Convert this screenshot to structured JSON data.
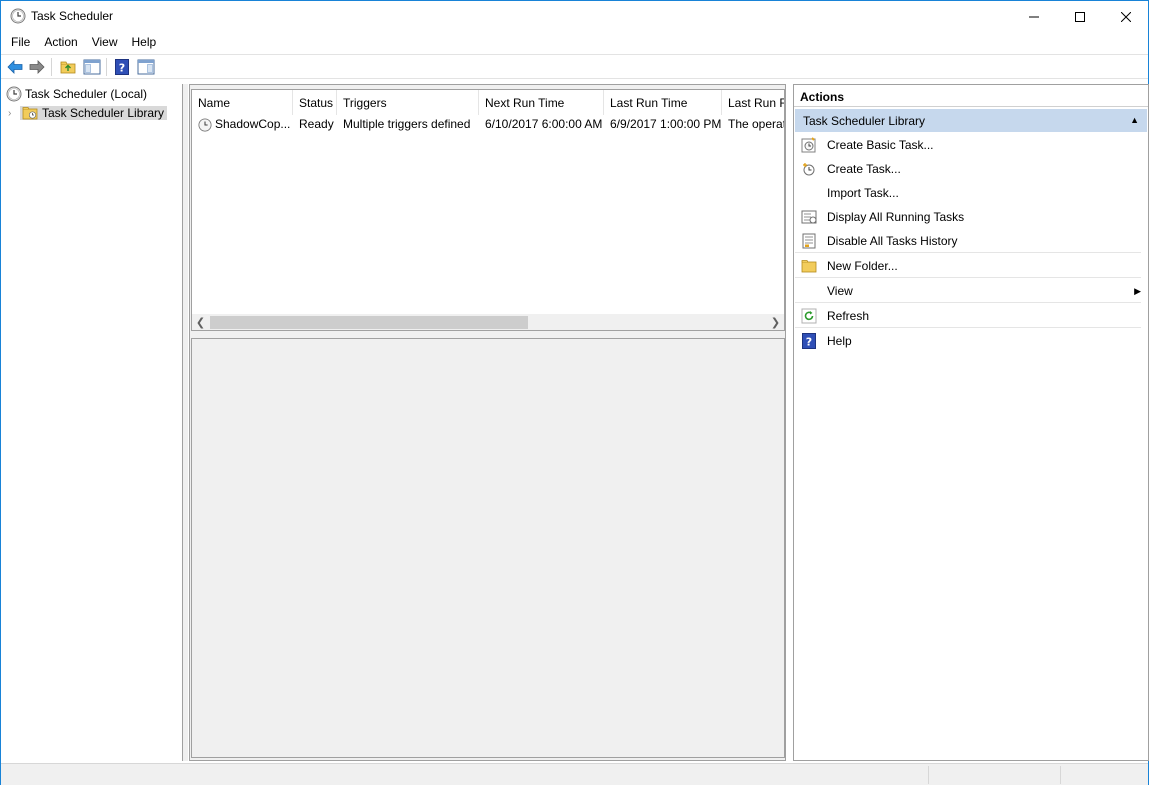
{
  "window": {
    "title": "Task Scheduler",
    "controls": {
      "minimize": "minimize",
      "maximize": "maximize",
      "close": "close"
    }
  },
  "menu": [
    "File",
    "Action",
    "View",
    "Help"
  ],
  "toolbar": {
    "buttons": [
      "back-arrow-icon",
      "forward-arrow-icon",
      "up-folder-icon",
      "show-hide-console-tree-icon",
      "help-icon",
      "show-hide-action-pane-icon"
    ]
  },
  "tree": {
    "root": "Task Scheduler (Local)",
    "child": "Task Scheduler Library"
  },
  "tasklist": {
    "columns": [
      "Name",
      "Status",
      "Triggers",
      "Next Run Time",
      "Last Run Time",
      "Last Run R"
    ],
    "rows": [
      {
        "name": "ShadowCop...",
        "status": "Ready",
        "triggers": "Multiple triggers defined",
        "next_run": "6/10/2017 6:00:00 AM",
        "last_run": "6/9/2017 1:00:00 PM",
        "last_result": "The operat"
      }
    ]
  },
  "actions": {
    "title": "Actions",
    "section": "Task Scheduler Library",
    "items": [
      {
        "label": "Create Basic Task...",
        "icon": "create-basic-task-icon"
      },
      {
        "label": "Create Task...",
        "icon": "create-task-icon"
      },
      {
        "label": "Import Task...",
        "icon": ""
      },
      {
        "label": "Display All Running Tasks",
        "icon": "running-tasks-icon"
      },
      {
        "label": "Disable All Tasks History",
        "icon": "tasks-history-icon"
      },
      {
        "label": "New Folder...",
        "icon": "new-folder-icon"
      },
      {
        "label": "View",
        "icon": ""
      },
      {
        "label": "Refresh",
        "icon": "refresh-icon"
      },
      {
        "label": "Help",
        "icon": "help-icon"
      }
    ]
  },
  "colors": {
    "window_border": "#1883d7",
    "section_highlight": "#c6d8ed",
    "selection_gray": "#d9d9d9",
    "pane_bg": "#f0f0f0"
  }
}
